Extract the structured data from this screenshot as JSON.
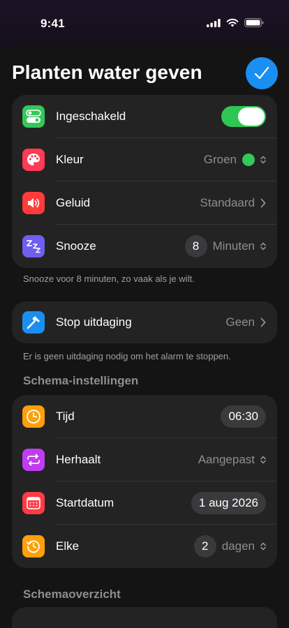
{
  "status_bar": {
    "time": "9:41"
  },
  "header": {
    "title": "Planten water geven",
    "done_icon": "checkmark-icon"
  },
  "general": {
    "enabled": {
      "label": "Ingeschakeld",
      "on": true,
      "icon": "toggle-icon",
      "color": "#34c759"
    },
    "color": {
      "label": "Kleur",
      "value": "Groen",
      "swatch": "#34c759",
      "icon": "palette-icon",
      "icon_bg": "#ff3b55"
    },
    "sound": {
      "label": "Geluid",
      "value": "Standaard",
      "icon": "speaker-icon",
      "icon_bg": "#ff3b3b"
    },
    "snooze": {
      "label": "Snooze",
      "count": "8",
      "unit": "Minuten",
      "icon": "zzz-icon",
      "icon_bg": "#6e5ff0"
    },
    "footnote": "Snooze voor 8 minuten, zo vaak als je wilt."
  },
  "challenge": {
    "label": "Stop uitdaging",
    "value": "Geen",
    "icon": "hammer-icon",
    "icon_bg": "#1a8ff0",
    "footnote": "Er is geen uitdaging nodig om het alarm te stoppen."
  },
  "schedule": {
    "header": "Schema-instellingen",
    "time": {
      "label": "Tijd",
      "value": "06:30",
      "icon": "clock-icon",
      "icon_bg": "#ff9f0a"
    },
    "repeat": {
      "label": "Herhaalt",
      "value": "Aangepast",
      "icon": "repeat-icon",
      "icon_bg": "#bf3cf0"
    },
    "start": {
      "label": "Startdatum",
      "value": "1 aug 2026",
      "icon": "calendar-icon",
      "icon_bg": "#ff3b45"
    },
    "every": {
      "label": "Elke",
      "count": "2",
      "unit": "dagen",
      "icon": "history-icon",
      "icon_bg": "#ff9f0a"
    }
  },
  "overview": {
    "header": "Schemaoverzicht"
  }
}
